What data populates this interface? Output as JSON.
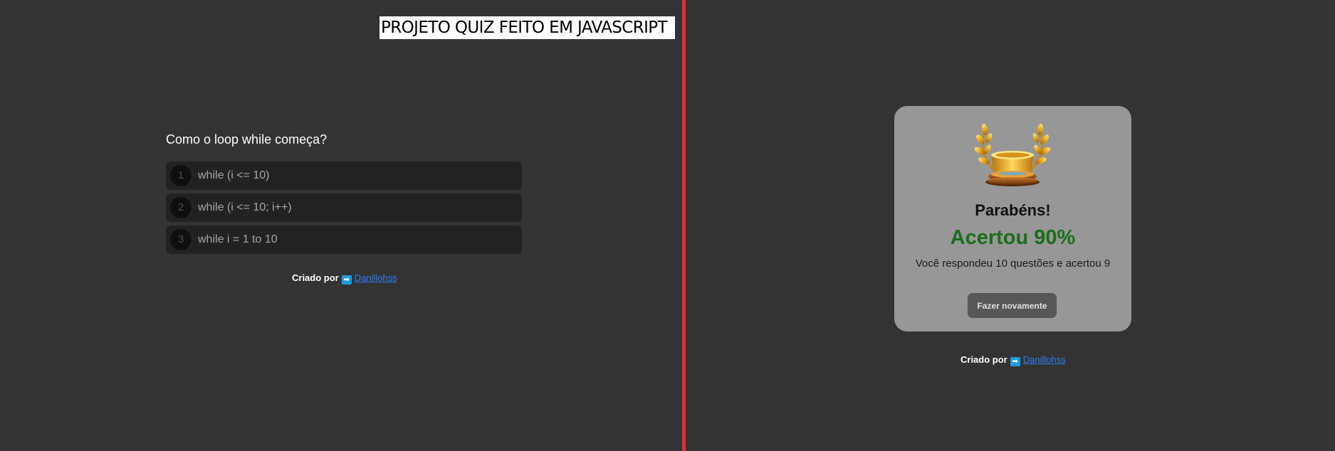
{
  "banner": {
    "title": "PROJETO QUIZ FEITO EM JAVASCRIPT"
  },
  "quiz": {
    "question": "Como o loop while começa?",
    "answers": [
      {
        "number": "1",
        "label": "while (i <= 10)"
      },
      {
        "number": "2",
        "label": "while (i <= 10; i++)"
      },
      {
        "number": "3",
        "label": "while i = 1 to 10"
      }
    ]
  },
  "footer": {
    "created_by": "Criado por",
    "arrow_icon": "right-arrow-emoji-icon",
    "arrow_glyph": "➡",
    "author_link": "Danillohss"
  },
  "result": {
    "trophy_icon": "golden-laurel-trophy-icon",
    "title": "Parabéns!",
    "score": "Acertou 90%",
    "summary": "Você respondeu 10 questões e acertou 9",
    "retry_label": "Fazer novamente"
  },
  "colors": {
    "background": "#333333",
    "divider": "#e22b33",
    "card": "#979797",
    "score": "#1a6e1a",
    "link": "#2f7cf6"
  }
}
